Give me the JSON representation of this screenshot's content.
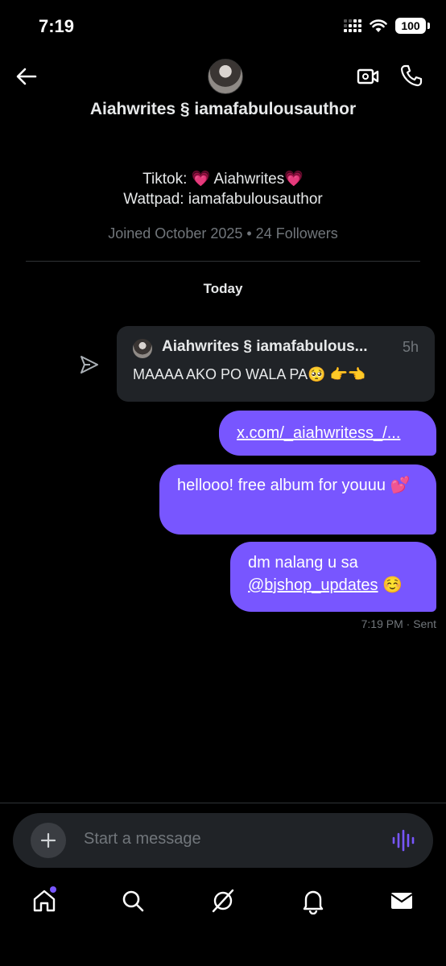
{
  "status_bar": {
    "time": "7:19",
    "battery": "100"
  },
  "header": {
    "title": "Aiahwrites § iamafabulousauthor",
    "bio_line1": "Tiktok: 💗 Aiahwrites💗",
    "bio_line2": "Wattpad: iamafabulousauthor",
    "joined": "Joined October 2025 • 24 Followers"
  },
  "conversation": {
    "date_label": "Today",
    "forwarded": {
      "name": "Aiahwrites § iamafabulous...",
      "time": "5h",
      "text": "MAAAA AKO PO WALA PA🥺 👉👈"
    },
    "messages": [
      {
        "text": "x.com/_aiahwritess_/..."
      },
      {
        "text": "hellooo! free album for youuu 💕"
      },
      {
        "text_before": "dm nalang u sa ",
        "mention": "@bjshop_updates",
        "text_after": " ☺️"
      }
    ],
    "sent_time": "7:19 PM",
    "sent_status": "· Sent"
  },
  "composer": {
    "placeholder": "Start a message"
  },
  "colors": {
    "accent": "#7856ff",
    "background": "#000000",
    "card": "#202327"
  },
  "icons": [
    "back-arrow-icon",
    "video-call-icon",
    "phone-call-icon",
    "send-icon",
    "plus-icon",
    "voice-icon",
    "home-icon",
    "search-icon",
    "grok-icon",
    "notifications-icon",
    "messages-icon"
  ]
}
